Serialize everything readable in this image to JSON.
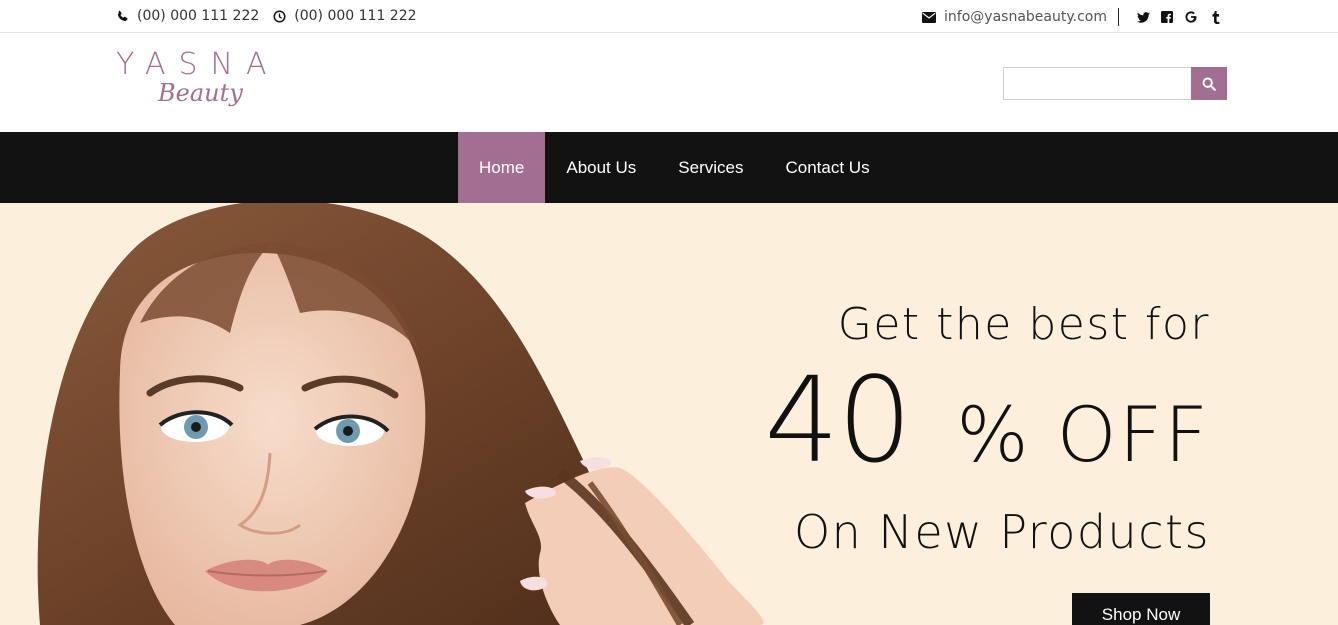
{
  "topbar": {
    "phone": "(00) 000 111 222",
    "hours": "(00) 000 111 222",
    "email": "info@yasnabeauty.com",
    "social": [
      "twitter-icon",
      "facebook-icon",
      "google-icon",
      "tumblr-icon"
    ]
  },
  "header": {
    "logo_word": "YASNA",
    "logo_sub": "Beauty",
    "search_placeholder": ""
  },
  "nav": {
    "items": [
      {
        "label": "Home",
        "active": true
      },
      {
        "label": "About Us",
        "active": false
      },
      {
        "label": "Services",
        "active": false
      },
      {
        "label": "Contact Us",
        "active": false
      }
    ]
  },
  "hero": {
    "line1": "Get the best for",
    "discount_number": "40",
    "discount_suffix": "% OFF",
    "line3": "On New Products",
    "button": "Shop Now"
  },
  "colors": {
    "accent": "#a26e92",
    "nav_bg": "#121212",
    "hero_bg": "#fcefdb"
  }
}
